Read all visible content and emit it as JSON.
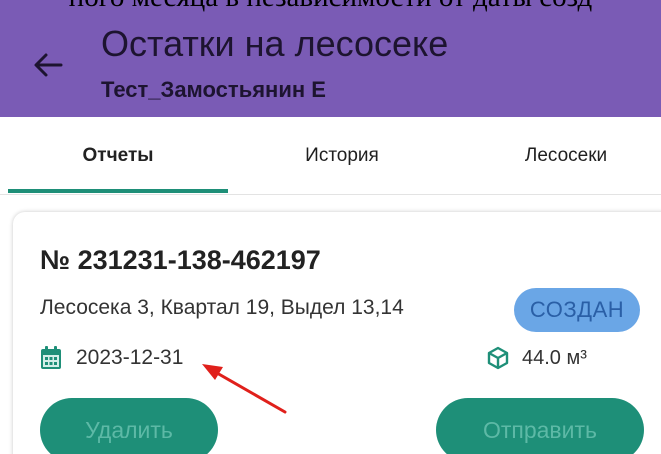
{
  "caption": {
    "text": "ного месяца в независимости от даты созд"
  },
  "appbar": {
    "title": "Остатки на лесосеке",
    "subtitle": "Тест_Замостьянин Е",
    "back_icon": "arrow-left-icon"
  },
  "tabs": [
    {
      "label": "Отчеты",
      "active": true
    },
    {
      "label": "История",
      "active": false
    },
    {
      "label": "Лесосеки",
      "active": false
    }
  ],
  "report": {
    "number": "№ 231231-138-462197",
    "location": "Лесосека 3, Квартал 19, Выдел 13,14",
    "status": "СОЗДАН",
    "date": "2023-12-31",
    "date_icon": "calendar-icon",
    "volume": "44.0 м³",
    "volume_icon": "cube-icon",
    "delete_label": "Удалить",
    "send_label": "Отправить"
  },
  "colors": {
    "appbar": "#7a5bb5",
    "accent": "#1e8f78",
    "status_badge": "#6aa6e6",
    "annotation_arrow": "#e0201b"
  }
}
